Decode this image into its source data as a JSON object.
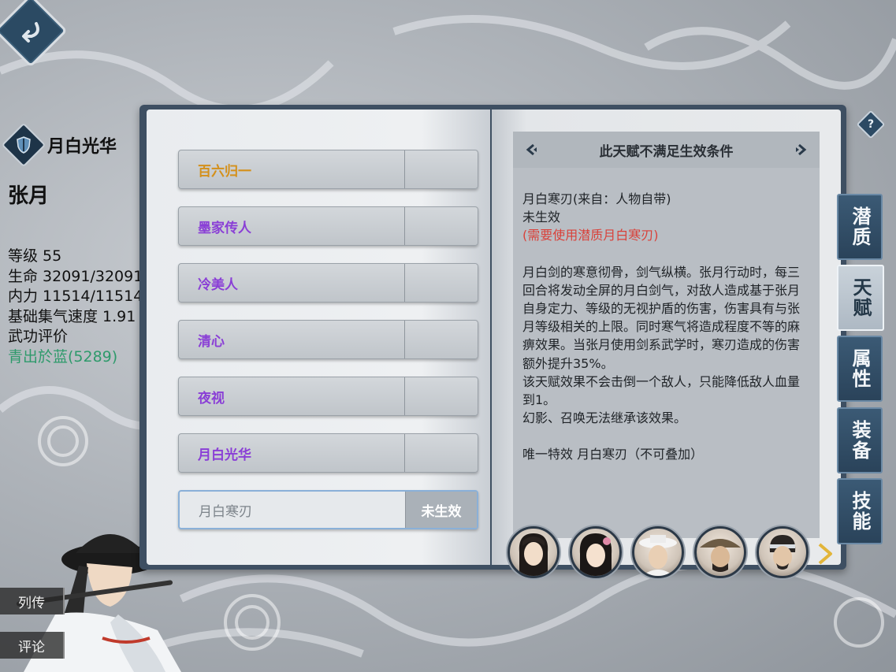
{
  "character": {
    "active_skill": "月白光华",
    "name": "张月",
    "stats": {
      "level": "等级 55",
      "hp": "生命 32091/32091",
      "mp": "内力 11514/11514",
      "qi_speed": "基础集气速度 1.91",
      "rating_label": "武功评价",
      "rating_value": "青出於蓝(5289)"
    }
  },
  "side_buttons": {
    "biography": "列传",
    "comments": "评论"
  },
  "talents": [
    {
      "name": "百六归一",
      "color": "#d4901a",
      "status": ""
    },
    {
      "name": "墨家传人",
      "color": "#8a3fd6",
      "status": ""
    },
    {
      "name": "冷美人",
      "color": "#8a3fd6",
      "status": ""
    },
    {
      "name": "清心",
      "color": "#8a3fd6",
      "status": ""
    },
    {
      "name": "夜视",
      "color": "#8a3fd6",
      "status": ""
    },
    {
      "name": "月白光华",
      "color": "#8a3fd6",
      "status": ""
    },
    {
      "name": "月白寒刃",
      "color": "#7c838a",
      "status": "未生效"
    }
  ],
  "detail": {
    "header": "此天赋不满足生效条件",
    "title": "月白寒刃(来自：人物自带)",
    "state": "未生效",
    "requirement": "(需要使用潜质月白寒刃)",
    "description": "月白剑的寒意彻骨，剑气纵横。张月行动时，每三回合将发动全屏的月白剑气，对敌人造成基于张月自身定力、等级的无视护盾的伤害，伤害具有与张月等级相关的上限。同时寒气将造成程度不等的麻痹效果。当张月使用剑系武学时，寒刃造成的伤害额外提升35%。",
    "note1": "该天赋效果不会击倒一个敌人，只能降低敌人血量到1。",
    "note2": "幻影、召唤无法继承该效果。",
    "unique": "唯一特效 月白寒刃（不可叠加）"
  },
  "tabs": [
    "潜质",
    "天赋",
    "属性",
    "装备",
    "技能"
  ],
  "active_tab": "天赋",
  "help_label": "?",
  "colors": {
    "accent_dark": "#2c4a64",
    "rank_green": "#2e9a6b",
    "requirement_red": "#d9413a",
    "orange_talent": "#d4901a",
    "purple_talent": "#8a3fd6"
  }
}
